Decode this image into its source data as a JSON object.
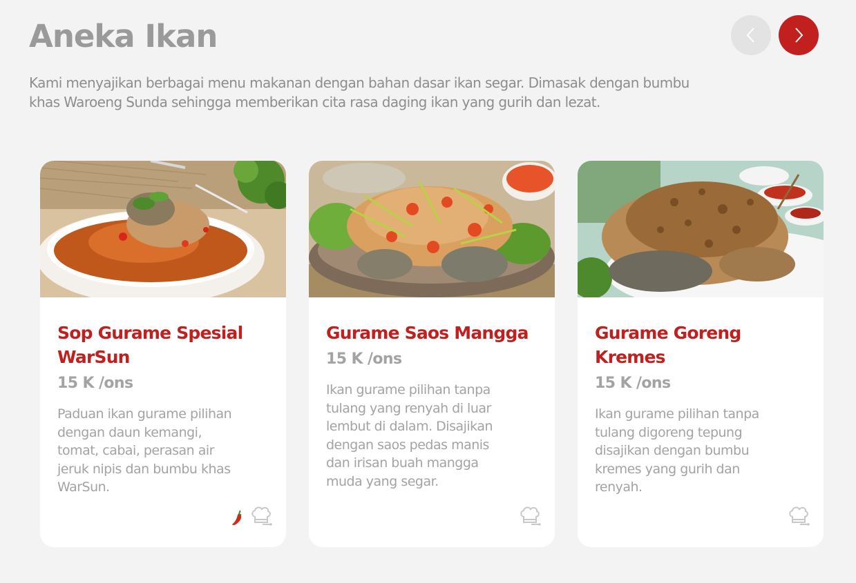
{
  "section": {
    "title": "Aneka Ikan",
    "description": "Kami menyajikan berbagai menu makanan dengan bahan dasar ikan segar. Dimasak dengan bumbu khas Waroeng Sunda sehingga memberikan cita rasa daging ikan yang gurih dan lezat."
  },
  "nav": {
    "prev_icon": "chevron-left-icon",
    "next_icon": "chevron-right-icon",
    "accent_color": "#c1201f",
    "disabled_color": "#e3e3e3"
  },
  "cards": [
    {
      "name": "Sop Gurame Spesial WarSun",
      "price": "15 K /ons",
      "description": "Paduan ikan gurame pilihan dengan daun kemangi, tomat, cabai, perasan air jeruk nipis dan bumbu khas WarSun.",
      "icons": [
        "chili-icon",
        "chef-hat-icon"
      ]
    },
    {
      "name": "Gurame Saos Mangga",
      "price": "15 K /ons",
      "description": "Ikan gurame pilihan tanpa tulang yang renyah di luar lembut di dalam. Disajikan dengan saos pedas manis dan irisan buah mangga muda yang segar.",
      "icons": [
        "chef-hat-icon"
      ]
    },
    {
      "name": "Gurame Goreng Kremes",
      "price": "15 K /ons",
      "description": "Ikan gurame pilihan tanpa tulang digoreng tepung disajikan dengan bumbu kremes yang gurih dan renyah.",
      "icons": [
        "chef-hat-icon"
      ]
    }
  ]
}
